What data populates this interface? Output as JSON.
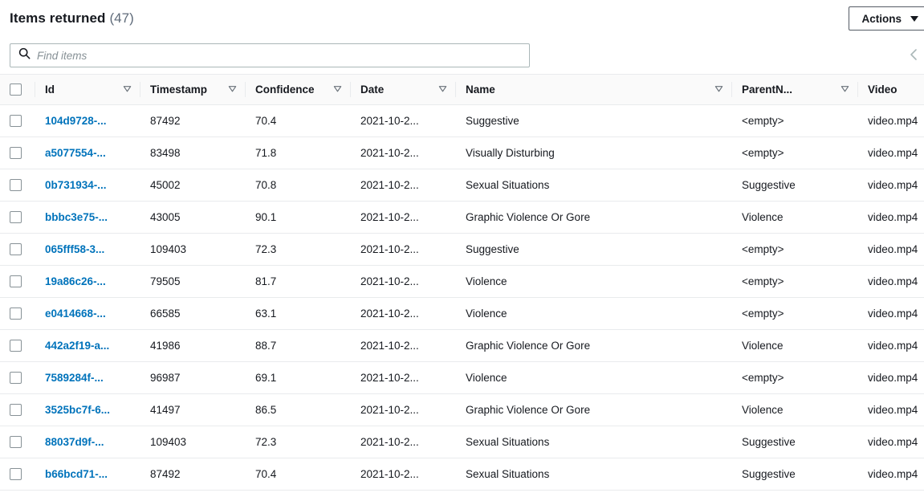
{
  "header": {
    "title": "Items returned",
    "count": "(47)",
    "actions_label": "Actions",
    "actions_caret_icon": "caret-down-icon"
  },
  "search": {
    "placeholder": "Find items",
    "value": "",
    "icon": "search-icon"
  },
  "pagination": {
    "prev_icon": "chevron-left-icon"
  },
  "colors": {
    "link": "#0073bb",
    "header_bg": "#fafafa",
    "border": "#e9ebed",
    "text": "#16191f",
    "muted": "#5f6b7a",
    "placeholder": "#879196"
  },
  "table": {
    "select_all_icon": "checkbox-unchecked-icon",
    "columns": [
      {
        "key": "id",
        "label": "Id",
        "sortable": true,
        "sort_icon": "sort-descending-icon"
      },
      {
        "key": "timestamp",
        "label": "Timestamp",
        "sortable": true,
        "sort_icon": "sort-descending-icon"
      },
      {
        "key": "confidence",
        "label": "Confidence",
        "sortable": true,
        "sort_icon": "sort-descending-icon"
      },
      {
        "key": "date",
        "label": "Date",
        "sortable": true,
        "sort_icon": "sort-descending-icon"
      },
      {
        "key": "name",
        "label": "Name",
        "sortable": true,
        "sort_icon": "sort-descending-icon"
      },
      {
        "key": "parentname",
        "label": "ParentN...",
        "sortable": true,
        "sort_icon": "sort-descending-icon"
      },
      {
        "key": "video",
        "label": "Video",
        "sortable": false,
        "sort_icon": ""
      }
    ],
    "rows": [
      {
        "id": "104d9728-...",
        "timestamp": "87492",
        "confidence": "70.4",
        "date": "2021-10-2...",
        "name": "Suggestive",
        "parentname": "<empty>",
        "video": "video.mp4"
      },
      {
        "id": "a5077554-...",
        "timestamp": "83498",
        "confidence": "71.8",
        "date": "2021-10-2...",
        "name": "Visually Disturbing",
        "parentname": "<empty>",
        "video": "video.mp4"
      },
      {
        "id": "0b731934-...",
        "timestamp": "45002",
        "confidence": "70.8",
        "date": "2021-10-2...",
        "name": "Sexual Situations",
        "parentname": "Suggestive",
        "video": "video.mp4"
      },
      {
        "id": "bbbc3e75-...",
        "timestamp": "43005",
        "confidence": "90.1",
        "date": "2021-10-2...",
        "name": "Graphic Violence Or Gore",
        "parentname": "Violence",
        "video": "video.mp4"
      },
      {
        "id": "065fff58-3...",
        "timestamp": "109403",
        "confidence": "72.3",
        "date": "2021-10-2...",
        "name": "Suggestive",
        "parentname": "<empty>",
        "video": "video.mp4"
      },
      {
        "id": "19a86c26-...",
        "timestamp": "79505",
        "confidence": "81.7",
        "date": "2021-10-2...",
        "name": "Violence",
        "parentname": "<empty>",
        "video": "video.mp4"
      },
      {
        "id": "e0414668-...",
        "timestamp": "66585",
        "confidence": "63.1",
        "date": "2021-10-2...",
        "name": "Violence",
        "parentname": "<empty>",
        "video": "video.mp4"
      },
      {
        "id": "442a2f19-a...",
        "timestamp": "41986",
        "confidence": "88.7",
        "date": "2021-10-2...",
        "name": "Graphic Violence Or Gore",
        "parentname": "Violence",
        "video": "video.mp4"
      },
      {
        "id": "7589284f-...",
        "timestamp": "96987",
        "confidence": "69.1",
        "date": "2021-10-2...",
        "name": "Violence",
        "parentname": "<empty>",
        "video": "video.mp4"
      },
      {
        "id": "3525bc7f-6...",
        "timestamp": "41497",
        "confidence": "86.5",
        "date": "2021-10-2...",
        "name": "Graphic Violence Or Gore",
        "parentname": "Violence",
        "video": "video.mp4"
      },
      {
        "id": "88037d9f-...",
        "timestamp": "109403",
        "confidence": "72.3",
        "date": "2021-10-2...",
        "name": "Sexual Situations",
        "parentname": "Suggestive",
        "video": "video.mp4"
      },
      {
        "id": "b66bcd71-...",
        "timestamp": "87492",
        "confidence": "70.4",
        "date": "2021-10-2...",
        "name": "Sexual Situations",
        "parentname": "Suggestive",
        "video": "video.mp4"
      }
    ]
  }
}
